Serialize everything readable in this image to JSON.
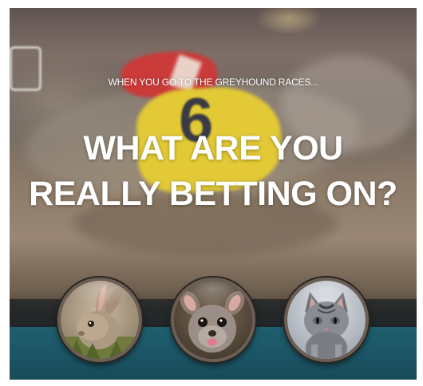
{
  "hero": {
    "eyebrow": "WHEN YOU GO TO THE GREYHOUND  RACES...",
    "headline_line1": "WHAT ARE YOU",
    "headline_line2": "REALLY BETTING ON?",
    "race_number": "6"
  },
  "animals": [
    {
      "name": "rabbit"
    },
    {
      "name": "possum"
    },
    {
      "name": "kitten"
    }
  ],
  "colors": {
    "headline": "#ffffff",
    "jacket_yellow": "#e2c935",
    "jacket_red": "#c93a39",
    "teal_band": "#1f5f6f"
  }
}
